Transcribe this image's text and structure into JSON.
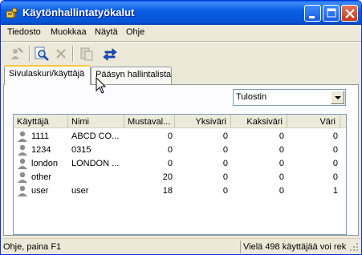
{
  "window": {
    "title": "Käytönhallintatyökalut",
    "accent": "#0a5fe3",
    "controls": [
      "minimize-icon",
      "maximize-icon",
      "close-icon"
    ]
  },
  "menu": [
    "Tiedosto",
    "Muokkaa",
    "Näytä",
    "Ohje"
  ],
  "toolbar": {
    "icons": [
      "user-edit-icon",
      "search-icon",
      "delete-icon",
      "paste-icon",
      "refresh-icon"
    ]
  },
  "tabs": [
    {
      "label": "Sivulaskuri/käyttäjä",
      "active": true
    },
    {
      "label": "Pääsyn hallintalista",
      "active": false
    }
  ],
  "view_select": {
    "value": "Tulostin"
  },
  "table": {
    "columns": [
      "Käyttäjä",
      "Nimi",
      "Mustaval...",
      "Yksiväri",
      "Kaksiväri",
      "Väri"
    ],
    "rows": [
      {
        "user": "1111",
        "name": "ABCD CO...",
        "mono": "0",
        "single": "0",
        "two": "0",
        "color": "0"
      },
      {
        "user": "1234",
        "name": "0315",
        "mono": "0",
        "single": "0",
        "two": "0",
        "color": "0"
      },
      {
        "user": "london",
        "name": "LONDON ...",
        "mono": "0",
        "single": "0",
        "two": "0",
        "color": "0"
      },
      {
        "user": "other",
        "name": "",
        "mono": "20",
        "single": "0",
        "two": "0",
        "color": "0"
      },
      {
        "user": "user",
        "name": "user",
        "mono": "18",
        "single": "0",
        "two": "0",
        "color": "1"
      }
    ]
  },
  "status": {
    "left": "Ohje, paina F1",
    "right": "Vielä 498 käyttäjää voi reki"
  }
}
